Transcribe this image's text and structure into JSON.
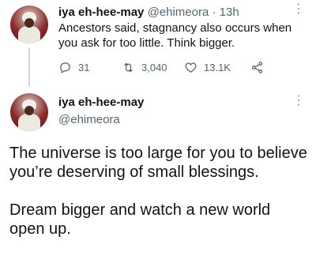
{
  "tweet1": {
    "name": "iya eh-hee-may",
    "handle": "@ehimeora",
    "separator": "·",
    "time": "13h",
    "text": "Ancestors said, stagnancy also occurs when you ask for too little. Think bigger.",
    "more": "⋮",
    "actions": {
      "replies": "31",
      "retweets": "3,040",
      "likes": "13.1K"
    }
  },
  "tweet2": {
    "name": "iya eh-hee-may",
    "handle": "@ehimeora",
    "more": "⋮",
    "paragraphs": [
      "The universe is too large for you to believe you’re deserving of small blessings.",
      "Dream bigger and watch a new world open up."
    ]
  },
  "colors": {
    "text": "#0f1419",
    "secondary": "#536471",
    "thread_line": "#cfd9de"
  }
}
